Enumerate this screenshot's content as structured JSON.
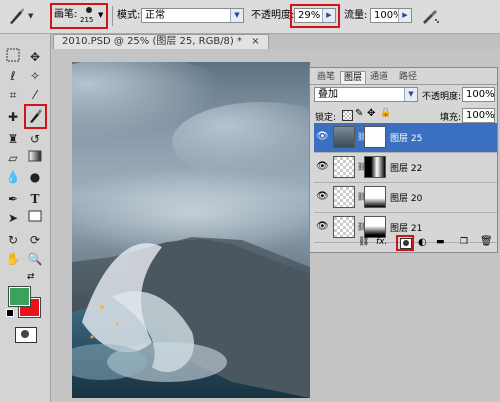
{
  "options_bar": {
    "brush_label": "画笔:",
    "brush_size": "215",
    "mode_label": "模式:",
    "mode_value": "正常",
    "opacity_label": "不透明度:",
    "opacity_value": "29%",
    "flow_label": "流量:",
    "flow_value": "100%"
  },
  "document": {
    "tab_title": "2010.PSD @ 25% (图层 25, RGB/8) *",
    "close_glyph": "×"
  },
  "panel": {
    "tabs": [
      "画笔",
      "图层",
      "通道",
      "路径"
    ],
    "active_tab": "图层",
    "blend_mode": "叠加",
    "opacity_label": "不透明度:",
    "opacity_value": "100%",
    "lock_label": "锁定:",
    "fill_label": "填充:",
    "fill_value": "100%",
    "layers": [
      {
        "name": "图层 25",
        "selected": true
      },
      {
        "name": "图层 22",
        "selected": false
      },
      {
        "name": "图层 20",
        "selected": false
      },
      {
        "name": "图层 21",
        "selected": false
      }
    ],
    "footer_fx": "fx."
  },
  "colors": {
    "highlight": "#d0141c",
    "foreground": "#3aa35a",
    "background": "#e8141c",
    "selection": "#3b6fc0"
  }
}
